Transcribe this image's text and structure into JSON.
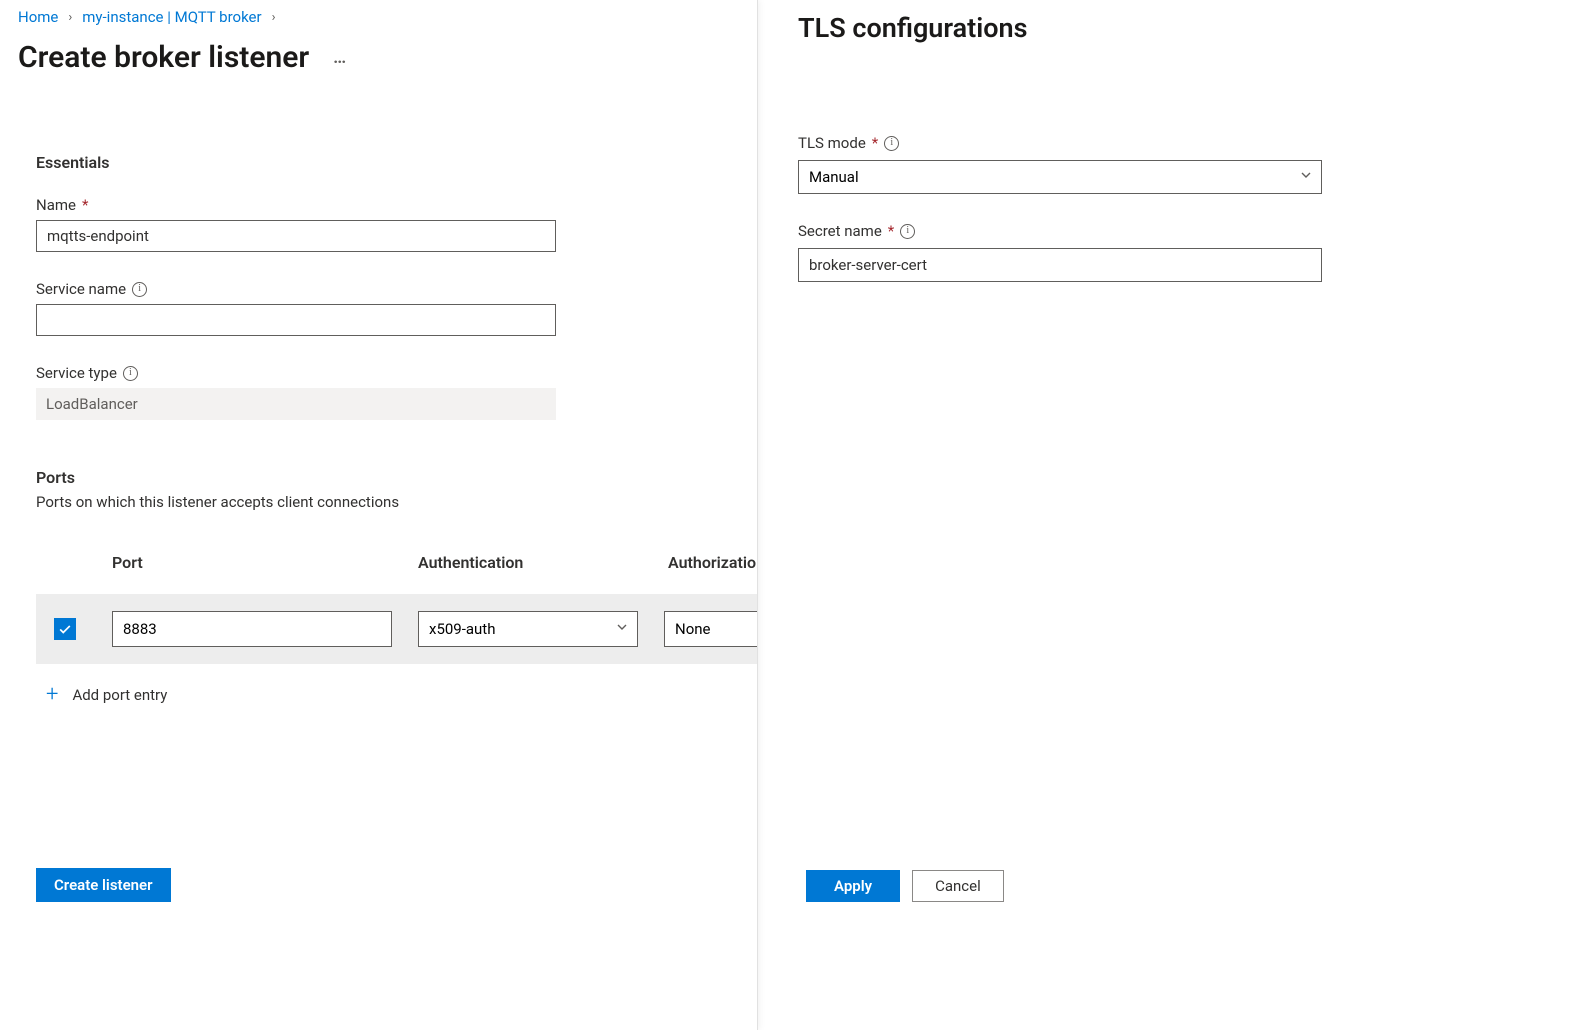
{
  "breadcrumb": {
    "home": "Home",
    "instance": "my-instance | MQTT broker"
  },
  "page": {
    "title": "Create broker listener"
  },
  "essentials": {
    "heading": "Essentials",
    "name_label": "Name",
    "name_value": "mqtts-endpoint",
    "service_name_label": "Service name",
    "service_name_value": "",
    "service_type_label": "Service type",
    "service_type_value": "LoadBalancer"
  },
  "ports": {
    "heading": "Ports",
    "description": "Ports on which this listener accepts client connections",
    "columns": {
      "port": "Port",
      "auth": "Authentication",
      "authz": "Authorization"
    },
    "row": {
      "port": "8883",
      "auth": "x509-auth",
      "authz": "None"
    },
    "add_label": "Add port entry"
  },
  "buttons": {
    "create": "Create listener",
    "apply": "Apply",
    "cancel": "Cancel"
  },
  "panel": {
    "title": "TLS configurations",
    "tls_mode_label": "TLS mode",
    "tls_mode_value": "Manual",
    "secret_name_label": "Secret name",
    "secret_name_value": "broker-server-cert"
  }
}
